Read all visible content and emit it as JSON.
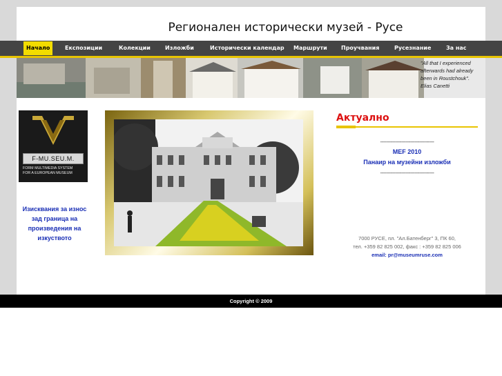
{
  "header": {
    "title": "Регионален исторически музей - Русе"
  },
  "nav": {
    "items": [
      {
        "label": "Начало"
      },
      {
        "label": "Експозиции"
      },
      {
        "label": "Колекции"
      },
      {
        "label": "Изложби"
      },
      {
        "label": "Исторически календар"
      },
      {
        "label": "Маршрути"
      },
      {
        "label": "Проучвания"
      },
      {
        "label": "Русезнание"
      },
      {
        "label": "За нас"
      }
    ]
  },
  "banner": {
    "quote_line1": "\"All that I experienced",
    "quote_line2": "afterwards had already",
    "quote_line3": "been in Roustchouk\".",
    "quote_author": "Elias Canetti"
  },
  "logo": {
    "name": "F-MU.SEU.M.",
    "subtitle_line1": "FORM MULTIMEDIA SYSTEM",
    "subtitle_line2": "FOR A EUROPEAN MUSEUM"
  },
  "left_link": {
    "line1": "Изисквания за износ",
    "line2": "зад граница на",
    "line3": "произведения на",
    "line4": "изкуството"
  },
  "news": {
    "title": "Актуално",
    "divider": "------------------------------------",
    "item1": "MEF 2010",
    "item2": "Панаир на музейни изложби"
  },
  "contact": {
    "address": "7000 РУСЕ, пл. \"Ал.Батенберг\" 3, ПК 60,",
    "phone": "тел. +359 82 825 002, факс : +359 82 825 006",
    "email": "email: pr@museumruse.com"
  },
  "footer": {
    "copyright": "Copyright © 2009"
  },
  "colors": {
    "nav_bg": "#444444",
    "accent_yellow": "#e8c400",
    "news_title": "#dd1111",
    "link_blue": "#1a2fb5"
  }
}
